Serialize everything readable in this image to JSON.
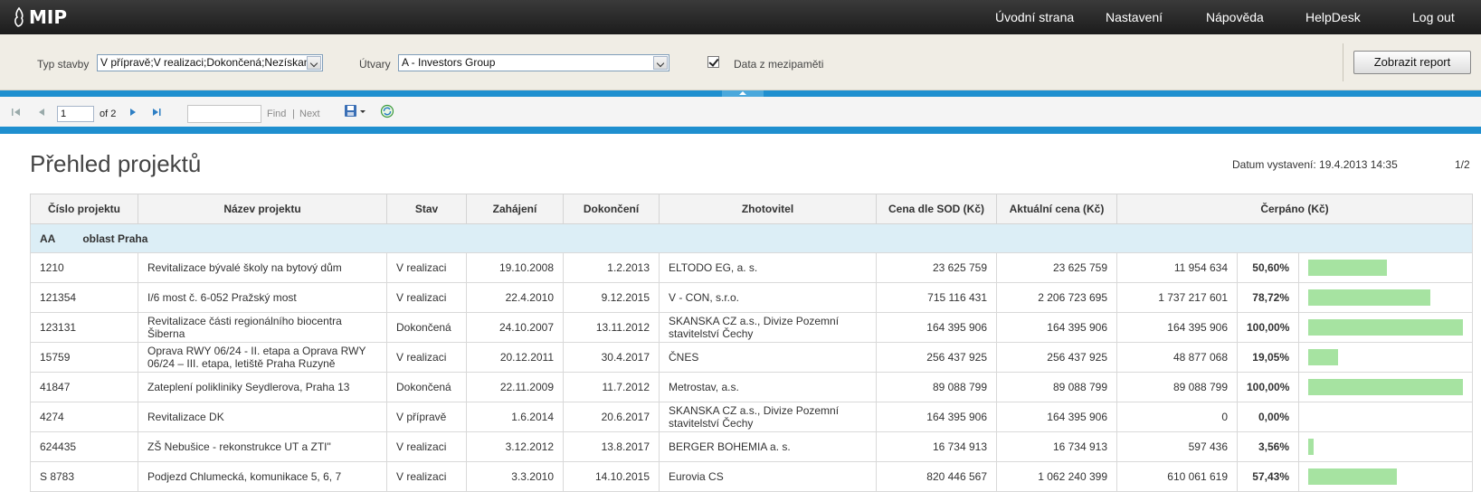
{
  "app": {
    "logo_text": "MIP"
  },
  "nav": [
    {
      "label": "Úvodní strana"
    },
    {
      "label": "Nastavení"
    },
    {
      "label": "Nápověda"
    },
    {
      "label": "HelpDesk"
    },
    {
      "label": "Log out"
    }
  ],
  "params": {
    "typ_label": "Typ stavby",
    "typ_value": "V přípravě;V realizaci;Dokončená;Nezískan",
    "utvary_label": "Útvary",
    "utvary_value": "A - Investors Group",
    "cache_label": "Data z mezipaměti",
    "cache_checked": true,
    "report_button": "Zobrazit report"
  },
  "toolbar": {
    "page_value": "1",
    "of_label": "of 2",
    "find_label": "Find",
    "separator": "|",
    "next_label": "Next"
  },
  "report": {
    "title": "Přehled projektů",
    "issued": "Datum vystavení: 19.4.2013 14:35",
    "page": "1/2",
    "columns": [
      "Číslo projektu",
      "Název projektu",
      "Stav",
      "Zahájení",
      "Dokončení",
      "Zhotovitel",
      "Cena dle SOD (Kč)",
      "Aktuální cena (Kč)",
      "Čerpáno (Kč)"
    ],
    "group": {
      "code": "AA",
      "name": "oblast Praha"
    },
    "rows": [
      {
        "cislo": "1210",
        "nazev": "Revitalizace bývalé školy na bytový dům",
        "stav": "V realizaci",
        "zahajeni": "19.10.2008",
        "dokonceni": "1.2.2013",
        "zhotovitel": "ELTODO EG, a. s.",
        "cena_sod": "23 625 759",
        "aktualni": "23 625 759",
        "cerpano": "11 954 634",
        "pct_label": "50,60%",
        "pct": 50.6
      },
      {
        "cislo": "121354",
        "nazev": "I/6 most č. 6-052 Pražský most",
        "stav": "V realizaci",
        "zahajeni": "22.4.2010",
        "dokonceni": "9.12.2015",
        "zhotovitel": "V - CON, s.r.o.",
        "cena_sod": "715 116 431",
        "aktualni": "2 206 723 695",
        "cerpano": "1 737 217 601",
        "pct_label": "78,72%",
        "pct": 78.72
      },
      {
        "cislo": "123131",
        "nazev": "Revitalizace části regionálního biocentra Šiberna",
        "stav": "Dokončená",
        "zahajeni": "24.10.2007",
        "dokonceni": "13.11.2012",
        "zhotovitel": "SKANSKA CZ a.s., Divize Pozemní stavitelství Čechy",
        "cena_sod": "164 395 906",
        "aktualni": "164 395 906",
        "cerpano": "164 395 906",
        "pct_label": "100,00%",
        "pct": 100
      },
      {
        "cislo": "15759",
        "nazev": "Oprava RWY 06/24 - II. etapa a Oprava RWY 06/24 – III. etapa, letiště Praha Ruzyně",
        "stav": "V realizaci",
        "zahajeni": "20.12.2011",
        "dokonceni": "30.4.2017",
        "zhotovitel": "ČNES",
        "cena_sod": "256 437 925",
        "aktualni": "256 437 925",
        "cerpano": "48 877 068",
        "pct_label": "19,05%",
        "pct": 19.05
      },
      {
        "cislo": "41847",
        "nazev": "Zateplení polikliniky Seydlerova, Praha 13",
        "stav": "Dokončená",
        "zahajeni": "22.11.2009",
        "dokonceni": "11.7.2012",
        "zhotovitel": "Metrostav, a.s.",
        "cena_sod": "89 088 799",
        "aktualni": "89 088 799",
        "cerpano": "89 088 799",
        "pct_label": "100,00%",
        "pct": 100
      },
      {
        "cislo": "4274",
        "nazev": "Revitalizace DK",
        "stav": "V přípravě",
        "zahajeni": "1.6.2014",
        "dokonceni": "20.6.2017",
        "zhotovitel": "SKANSKA CZ a.s., Divize Pozemní stavitelství Čechy",
        "cena_sod": "164 395 906",
        "aktualni": "164 395 906",
        "cerpano": "0",
        "pct_label": "0,00%",
        "pct": 0
      },
      {
        "cislo": "624435",
        "nazev": "ZŠ Nebušice - rekonstrukce UT a ZTI\"",
        "stav": "V realizaci",
        "zahajeni": "3.12.2012",
        "dokonceni": "13.8.2017",
        "zhotovitel": "BERGER BOHEMIA a. s.",
        "cena_sod": "16 734 913",
        "aktualni": "16 734 913",
        "cerpano": "597 436",
        "pct_label": "3,56%",
        "pct": 3.56
      },
      {
        "cislo": "S 8783",
        "nazev": "Podjezd Chlumecká, komunikace 5, 6, 7",
        "stav": "V realizaci",
        "zahajeni": "3.3.2010",
        "dokonceni": "14.10.2015",
        "zhotovitel": "Eurovia CS",
        "cena_sod": "820 446 567",
        "aktualni": "1 062 240 399",
        "cerpano": "610 061 619",
        "pct_label": "57,43%",
        "pct": 57.43
      }
    ]
  },
  "colors": {
    "accent_blue": "#1f8fcf",
    "group_row": "#dceef6",
    "bar_green": "#a6e3a1"
  }
}
